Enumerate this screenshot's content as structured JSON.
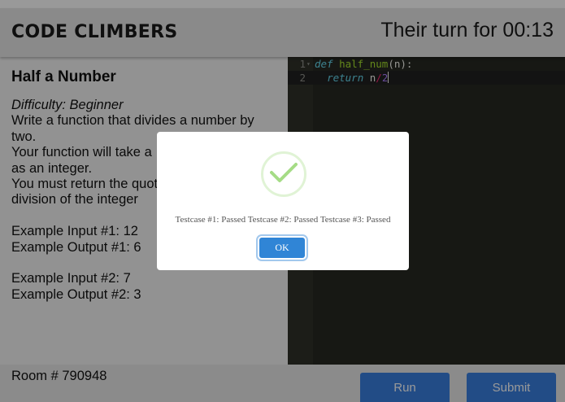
{
  "header": {
    "brand": "CODE CLIMBERS",
    "turn_status": "Their turn for 00:13"
  },
  "problem": {
    "title": "Half a Number",
    "difficulty": "Difficulty: Beginner",
    "lines": [
      "Write a function that divides a number by",
      "two.",
      "Your function will take a",
      "as an integer.",
      "You must return the quot",
      "division of the integer",
      "",
      "Example Input #1: 12",
      "Example Output #1: 6",
      "",
      "Example Input #2: 7",
      "Example Output #2: 3"
    ]
  },
  "editor": {
    "line_numbers": [
      "1",
      "2"
    ],
    "line1": {
      "kw": "def",
      "name": "half_num",
      "rest": "(n):"
    },
    "line2": {
      "kw": "return",
      "expr": "n",
      "op": "/",
      "num": "2"
    }
  },
  "footer": {
    "room": "Room # 790948",
    "run_label": "Run",
    "submit_label": "Submit"
  },
  "modal": {
    "icon": "check-icon",
    "message": "Testcase #1: Passed Testcase #2: Passed Testcase #3: Passed",
    "ok_label": "OK"
  },
  "colors": {
    "accent": "#3a7fe0",
    "editor_bg": "#272822",
    "success": "#a5dc86",
    "ok_button": "#3085d6"
  }
}
